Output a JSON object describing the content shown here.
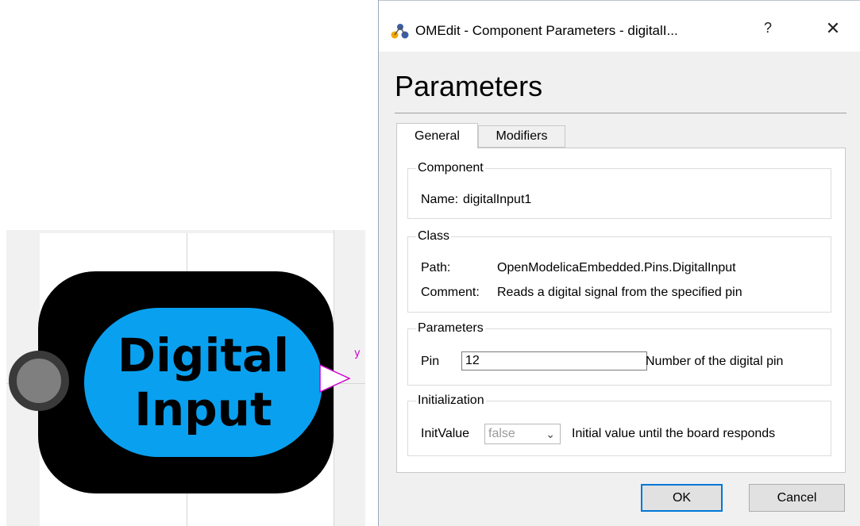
{
  "diagram": {
    "block_line1": "Digital",
    "block_line2": "Input",
    "output_label": "y",
    "colors": {
      "inner": "#0aa0f0",
      "outer": "#000000",
      "port_out": "#d000d0"
    }
  },
  "dialog": {
    "title": "OMEdit - Component Parameters - digitalI...",
    "help": "?",
    "close": "✕",
    "heading": "Parameters",
    "tabs": {
      "general": "General",
      "modifiers": "Modifiers"
    },
    "component": {
      "title": "Component",
      "name_label": "Name:",
      "name_value": "digitalInput1"
    },
    "class": {
      "title": "Class",
      "path_label": "Path:",
      "path_value": "OpenModelicaEmbedded.Pins.DigitalInput",
      "comment_label": "Comment:",
      "comment_value": "Reads a digital signal from the specified pin"
    },
    "parameters": {
      "title": "Parameters",
      "pin_label": "Pin",
      "pin_value": "12",
      "pin_desc": "Number of the digital pin"
    },
    "initialization": {
      "title": "Initialization",
      "init_label": "InitValue",
      "init_value": "false",
      "init_desc": "Initial value until the board responds"
    },
    "buttons": {
      "ok": "OK",
      "cancel": "Cancel"
    }
  }
}
